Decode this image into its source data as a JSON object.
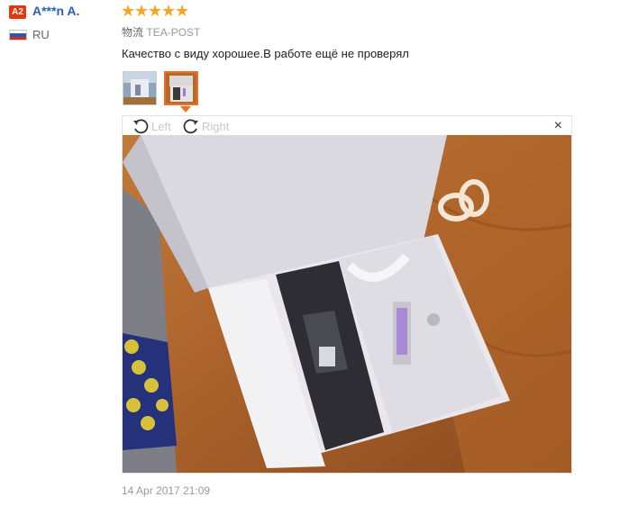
{
  "user": {
    "badge": "A2",
    "name": "A***n A.",
    "country": "RU",
    "flag_colors": [
      "#ffffff",
      "#2b56b0",
      "#d52b1e"
    ]
  },
  "review": {
    "rating": 5,
    "rating_max": 5,
    "star_glyph": "★",
    "logistics_label": "物流",
    "logistics_value": "TEA-POST",
    "text": "Качество с виду хорошее.В работе ещё не проверял",
    "date": "14 Apr 2017 21:09"
  },
  "viewer": {
    "rotate_left_label": "Left",
    "rotate_right_label": "Right",
    "close_glyph": "×",
    "selected_thumbnail": 2
  },
  "colors": {
    "accent": "#f06e2a",
    "star": "#f5a623",
    "username": "#2b5dbd",
    "badge": "#e2380b"
  }
}
